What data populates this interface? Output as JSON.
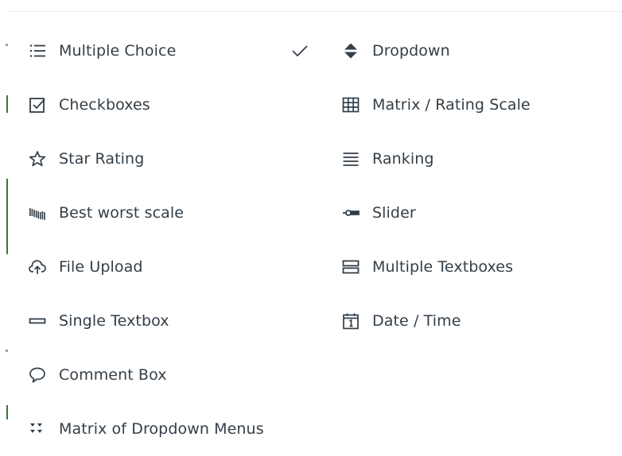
{
  "menu": {
    "left_items": [
      {
        "label": "Multiple Choice",
        "icon": "list-icon",
        "selected": true
      },
      {
        "label": "Checkboxes",
        "icon": "checkbox-icon"
      },
      {
        "label": "Star Rating",
        "icon": "star-icon"
      },
      {
        "label": "Best worst scale",
        "icon": "bars-icon"
      },
      {
        "label": "File Upload",
        "icon": "cloud-upload-icon"
      },
      {
        "label": "Single Textbox",
        "icon": "textbox-icon"
      },
      {
        "label": "Comment Box",
        "icon": "speech-bubble-icon"
      },
      {
        "label": "Matrix of Dropdown Menus",
        "icon": "dropdown-matrix-icon"
      }
    ],
    "right_items": [
      {
        "label": "Dropdown",
        "icon": "dropdown-arrows-icon"
      },
      {
        "label": "Matrix / Rating Scale",
        "icon": "grid-icon"
      },
      {
        "label": "Ranking",
        "icon": "lines-icon"
      },
      {
        "label": "Slider",
        "icon": "slider-icon"
      },
      {
        "label": "Multiple Textboxes",
        "icon": "textboxes-icon"
      },
      {
        "label": "Date / Time",
        "icon": "calendar-icon"
      }
    ]
  },
  "colors": {
    "text": "#333e48",
    "icon": "#333e48",
    "accent_edge": "#2e7d32"
  }
}
